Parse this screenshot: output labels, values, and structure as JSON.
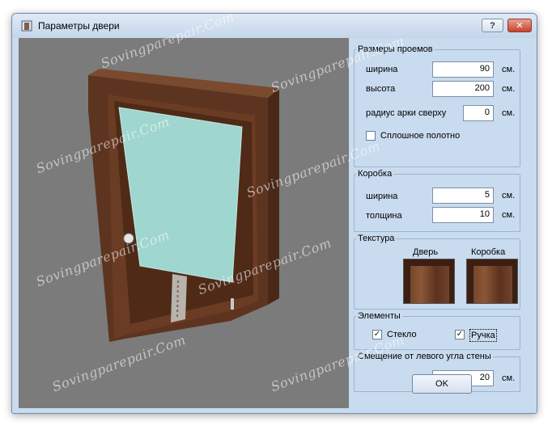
{
  "window": {
    "title": "Параметры двери"
  },
  "titlebar": {
    "help_label": "?",
    "close_label": "✕"
  },
  "openings": {
    "legend": "Размеры проемов",
    "width_label": "ширина",
    "width_value": "90",
    "height_label": "высота",
    "height_value": "200",
    "arch_label": "радиус арки сверху",
    "arch_value": "0",
    "unit": "см.",
    "solid_label": "Сплошное полотно",
    "solid_checked": false
  },
  "box": {
    "legend": "Коробка",
    "width_label": "ширина",
    "width_value": "5",
    "thickness_label": "толщина",
    "thickness_value": "10",
    "unit": "см."
  },
  "texture": {
    "legend": "Текстура",
    "door_label": "Дверь",
    "box_label": "Коробка"
  },
  "elements": {
    "legend": "Элементы",
    "glass_label": "Стекло",
    "glass_checked": true,
    "handle_label": "Ручка",
    "handle_checked": true
  },
  "offset": {
    "legend": "Смещение от левого угла стены",
    "value": "20",
    "unit": "см."
  },
  "ok_label": "OK",
  "watermark": "Sovingparepair.Com",
  "icons": [
    "app-icon",
    "help-icon",
    "close-icon",
    "check-icon"
  ],
  "colors": {
    "window_bg": "#c9dbee",
    "viewport_bg": "#7b7b7b",
    "glass": "#9fd6cf",
    "wood": "#5a3220"
  }
}
